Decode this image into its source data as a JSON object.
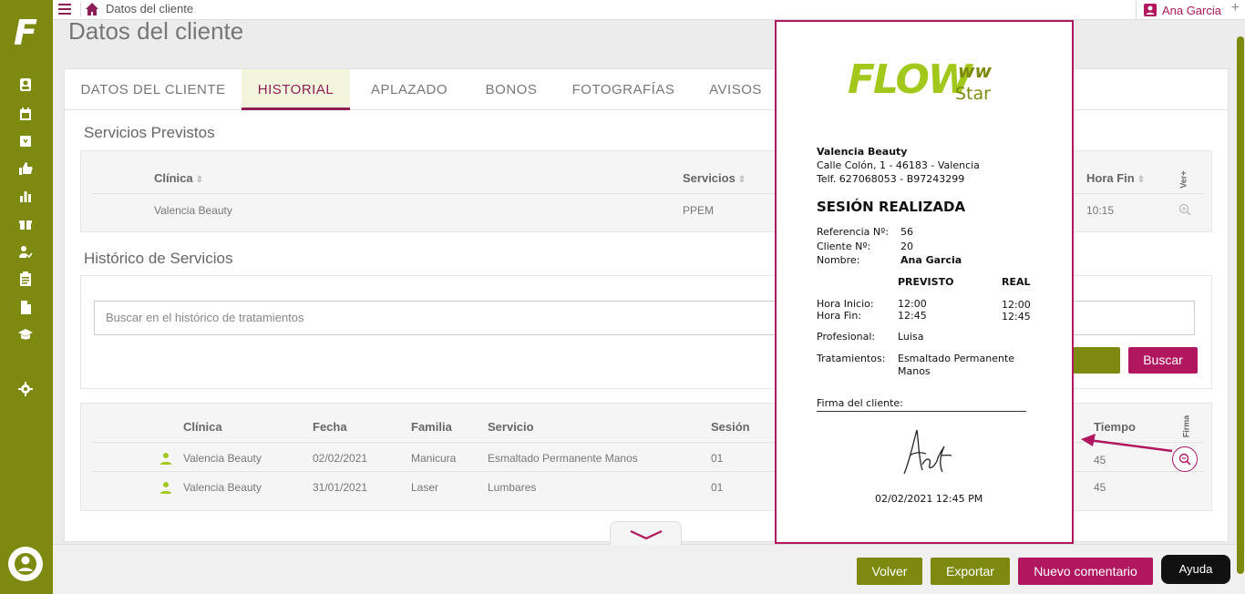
{
  "topbar": {
    "breadcrumb": "Datos del cliente",
    "user_name": "Ana Garcia",
    "add_label": "+"
  },
  "page": {
    "title": "Datos del cliente"
  },
  "tabs": [
    {
      "label": "DATOS DEL CLIENTE",
      "active": false
    },
    {
      "label": "HISTORIAL",
      "active": true
    },
    {
      "label": "APLAZADO",
      "active": false
    },
    {
      "label": "BONOS",
      "active": false
    },
    {
      "label": "FOTOGRAFÍAS",
      "active": false
    },
    {
      "label": "AVISOS",
      "active": false
    }
  ],
  "previstos": {
    "title": "Servicios Previstos",
    "headers": {
      "clinica": "Clínica",
      "servicios": "Servicios",
      "hora_fin": "Hora Fin",
      "ver": "Ver+"
    },
    "row": {
      "clinica": "Valencia Beauty",
      "servicios": "PPEM",
      "hora_fin": "10:15"
    }
  },
  "historico": {
    "title": "Histórico de Servicios",
    "search_placeholder": "Buscar en el histórico de tratamientos",
    "search_button": "Buscar",
    "headers": {
      "clinica": "Clínica",
      "fecha": "Fecha",
      "familia": "Familia",
      "servicio": "Servicio",
      "sesion": "Sesión",
      "tiempo": "Tiempo",
      "firma": "Firma"
    },
    "rows": [
      {
        "clinica": "Valencia Beauty",
        "fecha": "02/02/2021",
        "familia": "Manicura",
        "servicio": "Esmaltado Permanente Manos",
        "sesion": "01",
        "tiempo": "45"
      },
      {
        "clinica": "Valencia Beauty",
        "fecha": "31/01/2021",
        "familia": "Laser",
        "servicio": "Lumbares",
        "sesion": "01",
        "tiempo": "45"
      }
    ]
  },
  "bottom": {
    "volver": "Volver",
    "exportar": "Exportar",
    "nuevo_comentario": "Nuevo comentario",
    "ayuda": "Ayuda"
  },
  "receipt": {
    "logo_word": "FLOW",
    "logo_star": "Star",
    "logo_w": "ww",
    "company": "Valencia Beauty",
    "address": "Calle Colón, 1 - 46183 - Valencia",
    "phone": "Telf. 627068053 - B97243299",
    "heading": "SESIÓN REALIZADA",
    "ref_label": "Referencia Nº:",
    "ref_value": "56",
    "client_label": "Cliente Nº:",
    "client_value": "20",
    "name_label": "Nombre:",
    "name_value": "Ana Garcia",
    "col_previsto": "PREVISTO",
    "col_real": "REAL",
    "hora_inicio_label": "Hora Inicio:",
    "hora_inicio_prev": "12:00",
    "hora_inicio_real": "12:00",
    "hora_fin_label": "Hora Fin:",
    "hora_fin_prev": "12:45",
    "hora_fin_real": "12:45",
    "profesional_label": "Profesional:",
    "profesional_value": "Luisa",
    "tratamientos_label": "Tratamientos:",
    "tratamientos_value_1": "Esmaltado Permanente",
    "tratamientos_value_2": "Manos",
    "firma_label": "Firma del cliente:",
    "datetime": "02/02/2021 12:45 PM"
  },
  "colors": {
    "olive": "#7d8a0f",
    "magenta": "#b0175f",
    "lime": "#a3c81c"
  }
}
